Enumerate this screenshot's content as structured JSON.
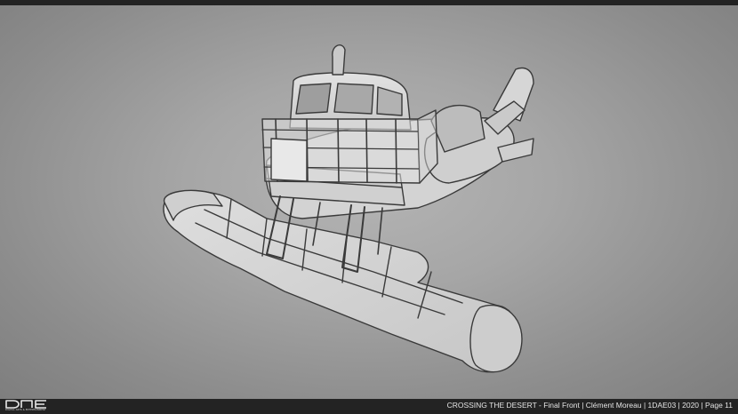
{
  "footer": {
    "logo_text": "DAE",
    "logo_tagline": "DIGITAL ARTS & ENTERTAINMENT",
    "caption": "CROSSING THE DESERT - Final Front | Clément Moreau | 1DAE03 | 2020 | Page 11"
  },
  "colors": {
    "background": "#a6a6a6",
    "bar": "#232323",
    "sketch_line": "#3a3a3a",
    "sketch_fill": "#d9d9d9"
  }
}
